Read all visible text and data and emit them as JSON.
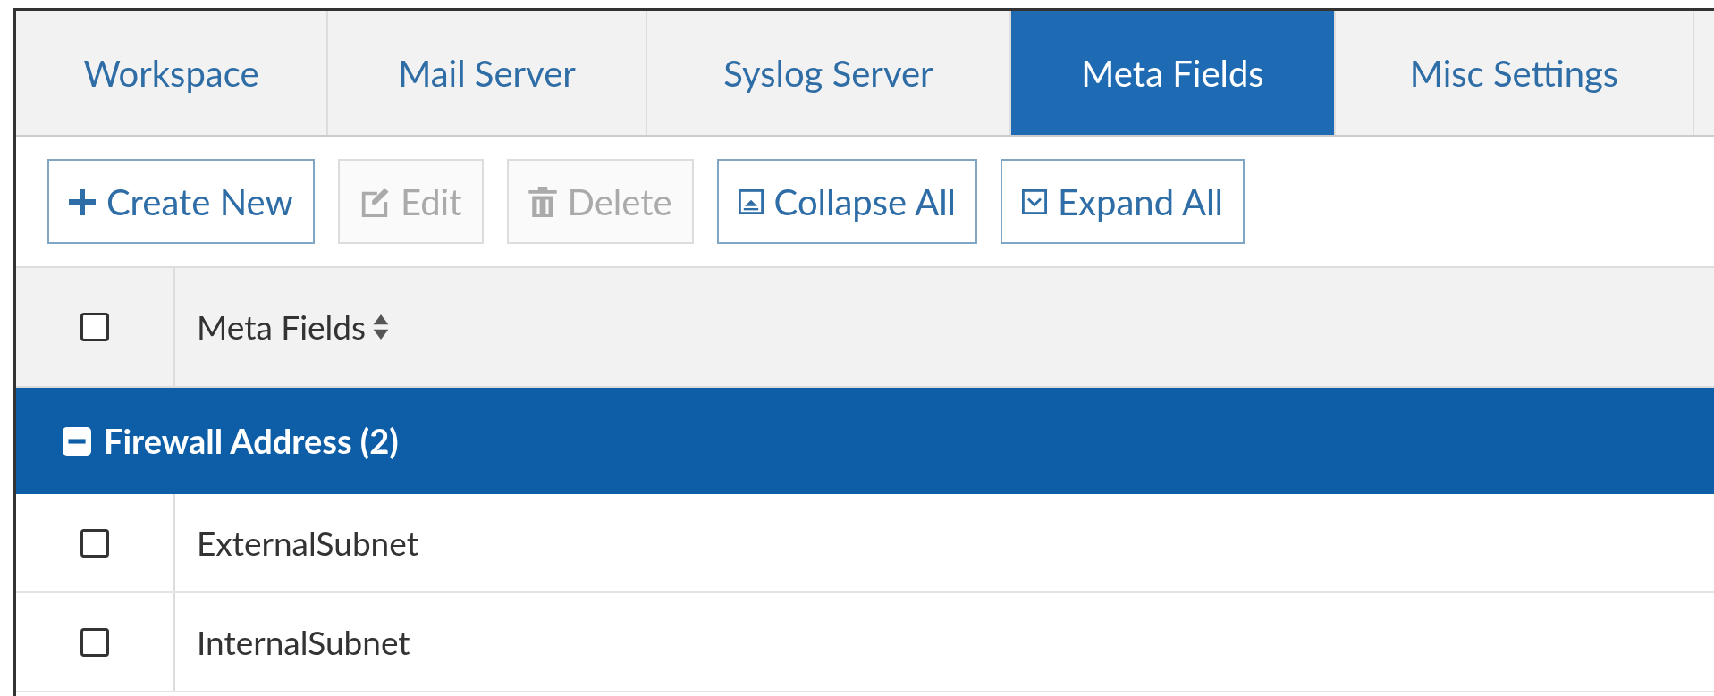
{
  "tabs": [
    {
      "label": "Workspace",
      "selected": false
    },
    {
      "label": "Mail Server",
      "selected": false
    },
    {
      "label": "Syslog Server",
      "selected": false
    },
    {
      "label": "Meta Fields",
      "selected": true
    },
    {
      "label": "Misc Settings",
      "selected": false
    }
  ],
  "toolbar": {
    "buttons": [
      {
        "kind": "plus",
        "label": "Create New",
        "disabled": false
      },
      {
        "kind": "edit",
        "label": "Edit",
        "disabled": true
      },
      {
        "kind": "trash",
        "label": "Delete",
        "disabled": true
      },
      {
        "kind": "collapse",
        "label": "Collapse All",
        "disabled": false
      },
      {
        "kind": "expand",
        "label": "Expand All",
        "disabled": false
      }
    ]
  },
  "table": {
    "header_checked": false,
    "column": {
      "label": "Meta Fields",
      "sortable": true
    },
    "groups": [
      {
        "label": "Firewall Address (2)",
        "expanded": true,
        "rows": [
          {
            "label": "ExternalSubnet",
            "checked": false
          },
          {
            "label": "InternalSubnet",
            "checked": false
          }
        ]
      }
    ]
  }
}
